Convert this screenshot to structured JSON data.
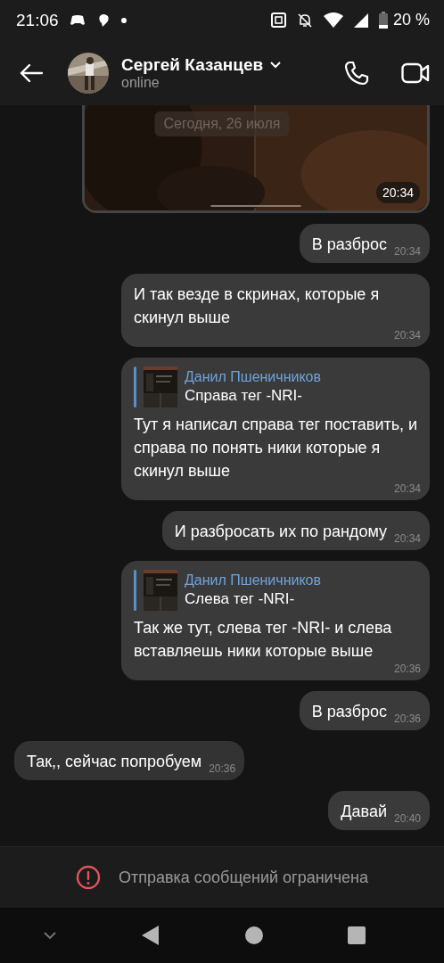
{
  "status_bar": {
    "time": "21:06",
    "battery": "20 %"
  },
  "header": {
    "name": "Сергей Казанцев",
    "status": "online"
  },
  "date_pill": "Сегодня, 26 июля",
  "messages": [
    {
      "outgoing": true,
      "time": "20:34"
    },
    {
      "kind": "text",
      "outgoing": true,
      "text": "В разброс",
      "time": "20:34"
    },
    {
      "kind": "text",
      "outgoing": true,
      "text": "И так везде в скринах, которые я скинул выше",
      "time": "20:34"
    },
    {
      "kind": "reply",
      "outgoing": true,
      "reply": {
        "author": "Данил Пшеничников",
        "text": "Справа тег -NRI-"
      },
      "text": "Тут я написал справа тег поставить, и справа по понять ники которые я скинул выше",
      "time": "20:34"
    },
    {
      "kind": "text",
      "outgoing": true,
      "text": "И разбросать их по рандому",
      "time": "20:34"
    },
    {
      "kind": "reply",
      "outgoing": true,
      "reply": {
        "author": "Данил Пшеничников",
        "text": "Слева тег -NRI-"
      },
      "text": "Так же тут, слева тег -NRI- и слева вставляешь ники которые выше",
      "time": "20:36"
    },
    {
      "kind": "text",
      "outgoing": true,
      "text": "В разброс",
      "time": "20:36"
    },
    {
      "kind": "text",
      "outgoing": false,
      "text": "Так,, сейчас попробуем",
      "time": "20:36"
    },
    {
      "kind": "text",
      "outgoing": true,
      "text": "Давай",
      "time": "20:40"
    }
  ],
  "notice": "Отправка сообщений ограничена"
}
